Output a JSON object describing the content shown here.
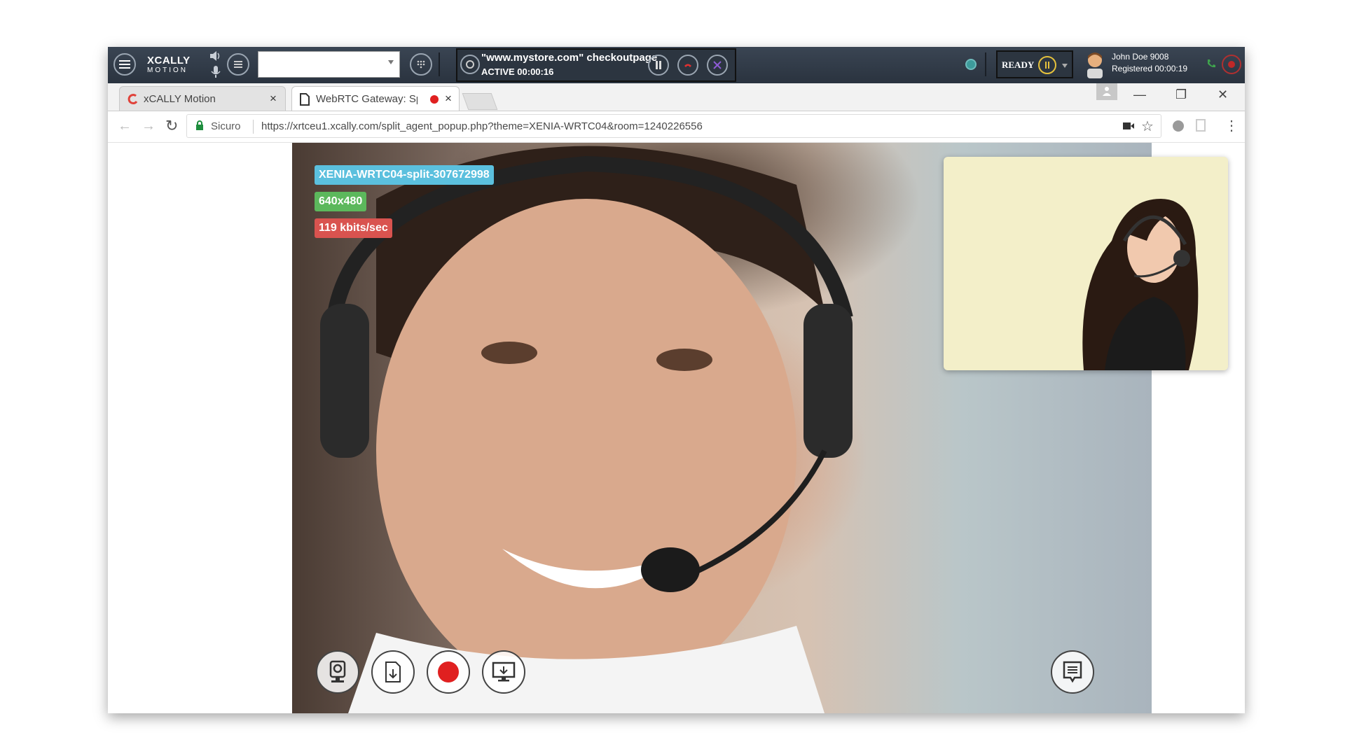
{
  "softphone": {
    "logo_text": "XCALLY",
    "logo_sub": "MOTION",
    "session_title": "\"www.mystore.com\" checkoutpage",
    "session_status": "ACTIVE 00:00:16",
    "ready_label": "READY",
    "agent_name": "John Doe 9008",
    "agent_status": "Registered 00:00:19"
  },
  "tabs": [
    {
      "label": "xCALLY Motion",
      "close": "×"
    },
    {
      "label": "WebRTC Gateway: Spl",
      "close": "×"
    }
  ],
  "window_controls": {
    "minimize": "—",
    "restore": "❐",
    "close": "✕"
  },
  "addressbar": {
    "secure_label": "Sicuro",
    "url": "https://xrtceu1.xcally.com/split_agent_popup.php?theme=XENIA-WRTC04&room=1240226556"
  },
  "video": {
    "room_badge": "XENIA-WRTC04-split-307672998",
    "resolution_badge": "640x480",
    "bitrate_badge": "119 kbits/sec"
  },
  "colors": {
    "room_badge": "#5bc0de",
    "resolution_badge": "#5cb85c",
    "bitrate_badge": "#d9534f",
    "record": "#e02020"
  },
  "icons": {
    "menu": "hamburger-icon",
    "snapshot": "webcam-icon",
    "download": "file-download-icon",
    "record": "record-icon",
    "screenshare": "monitor-icon",
    "chat": "chat-icon"
  }
}
